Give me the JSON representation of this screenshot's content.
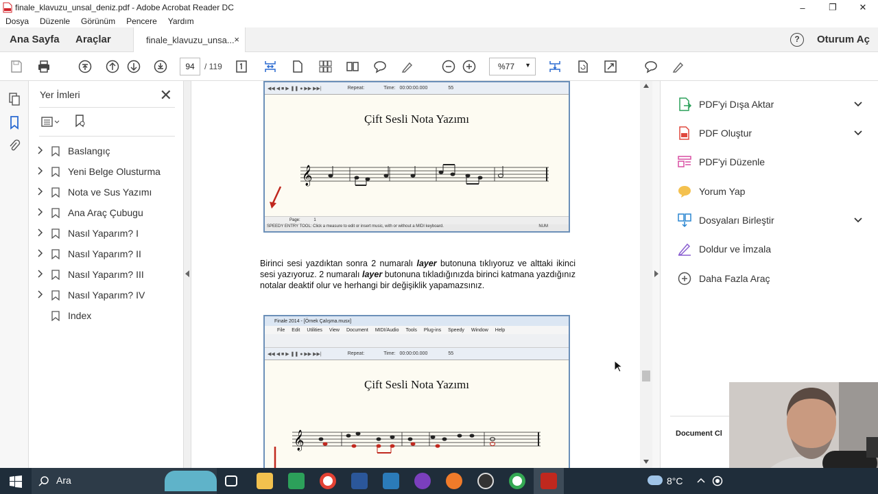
{
  "window": {
    "title": "finale_klavuzu_unsal_deniz.pdf - Adobe Acrobat Reader DC",
    "minimize": "–",
    "restore": "❐",
    "close": "✕"
  },
  "menu": [
    "Dosya",
    "Düzenle",
    "Görünüm",
    "Pencere",
    "Yardım"
  ],
  "tabs": {
    "home": "Ana Sayfa",
    "tools": "Araçlar",
    "document": "finale_klavuzu_unsa...",
    "close": "×",
    "help": "?",
    "signin": "Oturum Aç"
  },
  "toolbar": {
    "page_current": "94",
    "page_total": "/  119",
    "zoom": "%77",
    "zoom_arrow": "▼"
  },
  "bookmarks": {
    "header": "Yer İmleri",
    "close": "✕",
    "items": [
      {
        "label": "Baslangıç",
        "expandable": true
      },
      {
        "label": "Yeni Belge Olusturma",
        "expandable": true
      },
      {
        "label": "Nota ve Sus Yazımı",
        "expandable": true
      },
      {
        "label": "Ana Araç Çubugu",
        "expandable": true
      },
      {
        "label": "Nasıl Yaparım? I",
        "expandable": true
      },
      {
        "label": "Nasıl Yaparım? II",
        "expandable": true
      },
      {
        "label": "Nasıl Yaparım? III",
        "expandable": true
      },
      {
        "label": "Nasıl Yaparım? IV",
        "expandable": true
      },
      {
        "label": "Index",
        "expandable": false
      }
    ]
  },
  "right_tools": [
    {
      "label": "PDF'yi Dışa Aktar",
      "icon": "export-pdf-icon",
      "color": "#2ca05a",
      "dropdown": true
    },
    {
      "label": "PDF Oluştur",
      "icon": "create-pdf-icon",
      "color": "#e0483e",
      "dropdown": true
    },
    {
      "label": "PDF'yi Düzenle",
      "icon": "edit-pdf-icon",
      "color": "#d94fa3",
      "dropdown": false
    },
    {
      "label": "Yorum Yap",
      "icon": "comment-icon",
      "color": "#f2b630",
      "dropdown": false
    },
    {
      "label": "Dosyaları Birleştir",
      "icon": "combine-files-icon",
      "color": "#2a86d1",
      "dropdown": true
    },
    {
      "label": "Doldur ve İmzala",
      "icon": "fill-sign-icon",
      "color": "#8a5fd1",
      "dropdown": false
    },
    {
      "label": "Daha Fazla Araç",
      "icon": "more-tools-icon",
      "color": "#555555",
      "dropdown": false
    }
  ],
  "right_footer": "Document Cl",
  "document": {
    "shot1": {
      "title": "Çift Sesli Nota Yazımı",
      "transport_repeat": "Repeat:",
      "transport_time": "Time:",
      "transport_timeval": "00:00:00.000",
      "transport_tempo": "55",
      "page_label": "Page:",
      "page_value": "1",
      "status": "SPEEDY ENTRY TOOL: Click a measure to edit or insert music, with or without a MIDI keyboard.",
      "status_num": "NUM"
    },
    "paragraph_parts": {
      "p1": "Birinci sesi yazdıktan sonra 2 numaralı ",
      "b1": "layer",
      "p2": " butonuna tıklıyoruz ve alttaki ikinci sesi yazıyoruz.  2 numaralı ",
      "b2": "layer",
      "p3": " butonuna tıkladığınızda birinci katmana yazdığınız notalar deaktif olur ve herhangi bir değişiklik yapamazsınız."
    },
    "shot2": {
      "window_title": "Finale 2014 - [Örnek Çalışma.musx]",
      "menu": [
        "File",
        "Edit",
        "Utilities",
        "View",
        "Document",
        "MIDI/Audio",
        "Tools",
        "Plug-ins",
        "Speedy",
        "Window",
        "Help"
      ],
      "title": "Çift Sesli Nota Yazımı",
      "transport_repeat": "Repeat:",
      "transport_time": "Time:",
      "transport_timeval": "00:00:00.000",
      "transport_tempo": "55"
    }
  },
  "taskbar": {
    "search": "Ara",
    "temperature": "8°C"
  }
}
